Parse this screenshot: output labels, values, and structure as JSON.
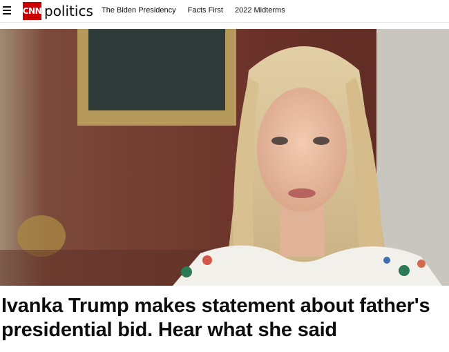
{
  "header": {
    "brand": "CNN",
    "section": "politics",
    "nav": [
      {
        "label": "The Biden Presidency"
      },
      {
        "label": "Facts First"
      },
      {
        "label": "2022 Midterms"
      }
    ]
  },
  "article": {
    "headline": "Ivanka Trump makes statement about father's presidential bid. Hear what she said"
  },
  "colors": {
    "brand_red": "#cc0000",
    "text": "#0c0c0c"
  },
  "icons": {
    "menu": "hamburger-menu-icon"
  }
}
